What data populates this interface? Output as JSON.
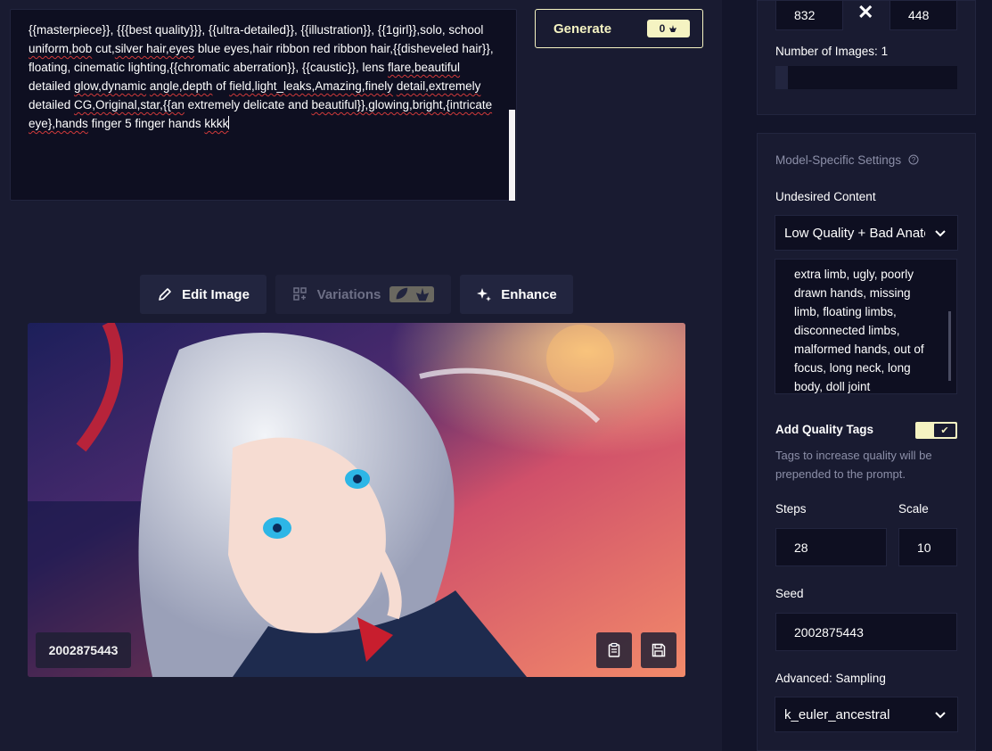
{
  "prompt": {
    "segments": [
      {
        "text": "{{masterpiece}}, {{{best quality}}}, {{ultra-detailed}}, {{illustration}}, {{1girl}},solo, school ",
        "sq": false
      },
      {
        "text": "uniform,bob",
        "sq": true
      },
      {
        "text": " cut,",
        "sq": false
      },
      {
        "text": "silver hair,eyes",
        "sq": true
      },
      {
        "text": " blue eyes,hair ribbon red ribbon hair,{{disheveled hair}}, floating,  cinematic lighting,{{chromatic aberration}}, {{caustic}}, lens ",
        "sq": false
      },
      {
        "text": "flare,beautiful",
        "sq": true
      },
      {
        "text": " detailed ",
        "sq": false
      },
      {
        "text": "glow,dynamic",
        "sq": true
      },
      {
        "text": " ",
        "sq": false
      },
      {
        "text": "angle,depth",
        "sq": true
      },
      {
        "text": " of ",
        "sq": false
      },
      {
        "text": "field,light_leaks,Amazing,finely",
        "sq": true
      },
      {
        "text": " ",
        "sq": false
      },
      {
        "text": "detail,extremely",
        "sq": true
      },
      {
        "text": " detailed ",
        "sq": false
      },
      {
        "text": "CG,Original,star,{{an",
        "sq": true
      },
      {
        "text": " extremely delicate and ",
        "sq": false
      },
      {
        "text": "beautiful}},glowing,bright,{intricate",
        "sq": true
      },
      {
        "text": " ",
        "sq": false
      },
      {
        "text": "eye},hands",
        "sq": true
      },
      {
        "text": " finger 5 finger hands ",
        "sq": false
      },
      {
        "text": "kkkk",
        "sq": true
      }
    ]
  },
  "generate": {
    "label": "Generate",
    "cost": "0"
  },
  "tools": {
    "edit_image": "Edit Image",
    "variations": "Variations",
    "enhance": "Enhance"
  },
  "image": {
    "seed_label": "2002875443"
  },
  "sidebar": {
    "width": "832",
    "height": "448",
    "times": "✕",
    "num_images_label": "Number of Images:",
    "num_images_value": "1",
    "model_settings_title": "Model-Specific Settings",
    "undesired_label": "Undesired Content",
    "undesired_preset": "Low Quality + Bad Anatomy",
    "undesired_text": "extra limb, ugly, poorly drawn hands, missing limb, floating limbs, disconnected limbs, malformed hands, out of focus, long neck, long body, doll joint",
    "quality_tags_label": "Add Quality Tags",
    "quality_tags_desc": "Tags to increase quality will be prepended to the prompt.",
    "quality_tags_on": true,
    "steps_label": "Steps",
    "steps_value": "28",
    "scale_label": "Scale",
    "scale_value": "10",
    "seed_label": "Seed",
    "seed_value": "2002875443",
    "sampling_label": "Advanced: Sampling",
    "sampling_value": "k_euler_ancestral"
  },
  "colors": {
    "accent": "#f5f3c2",
    "bg": "#191b31",
    "field": "#0e0f21"
  }
}
